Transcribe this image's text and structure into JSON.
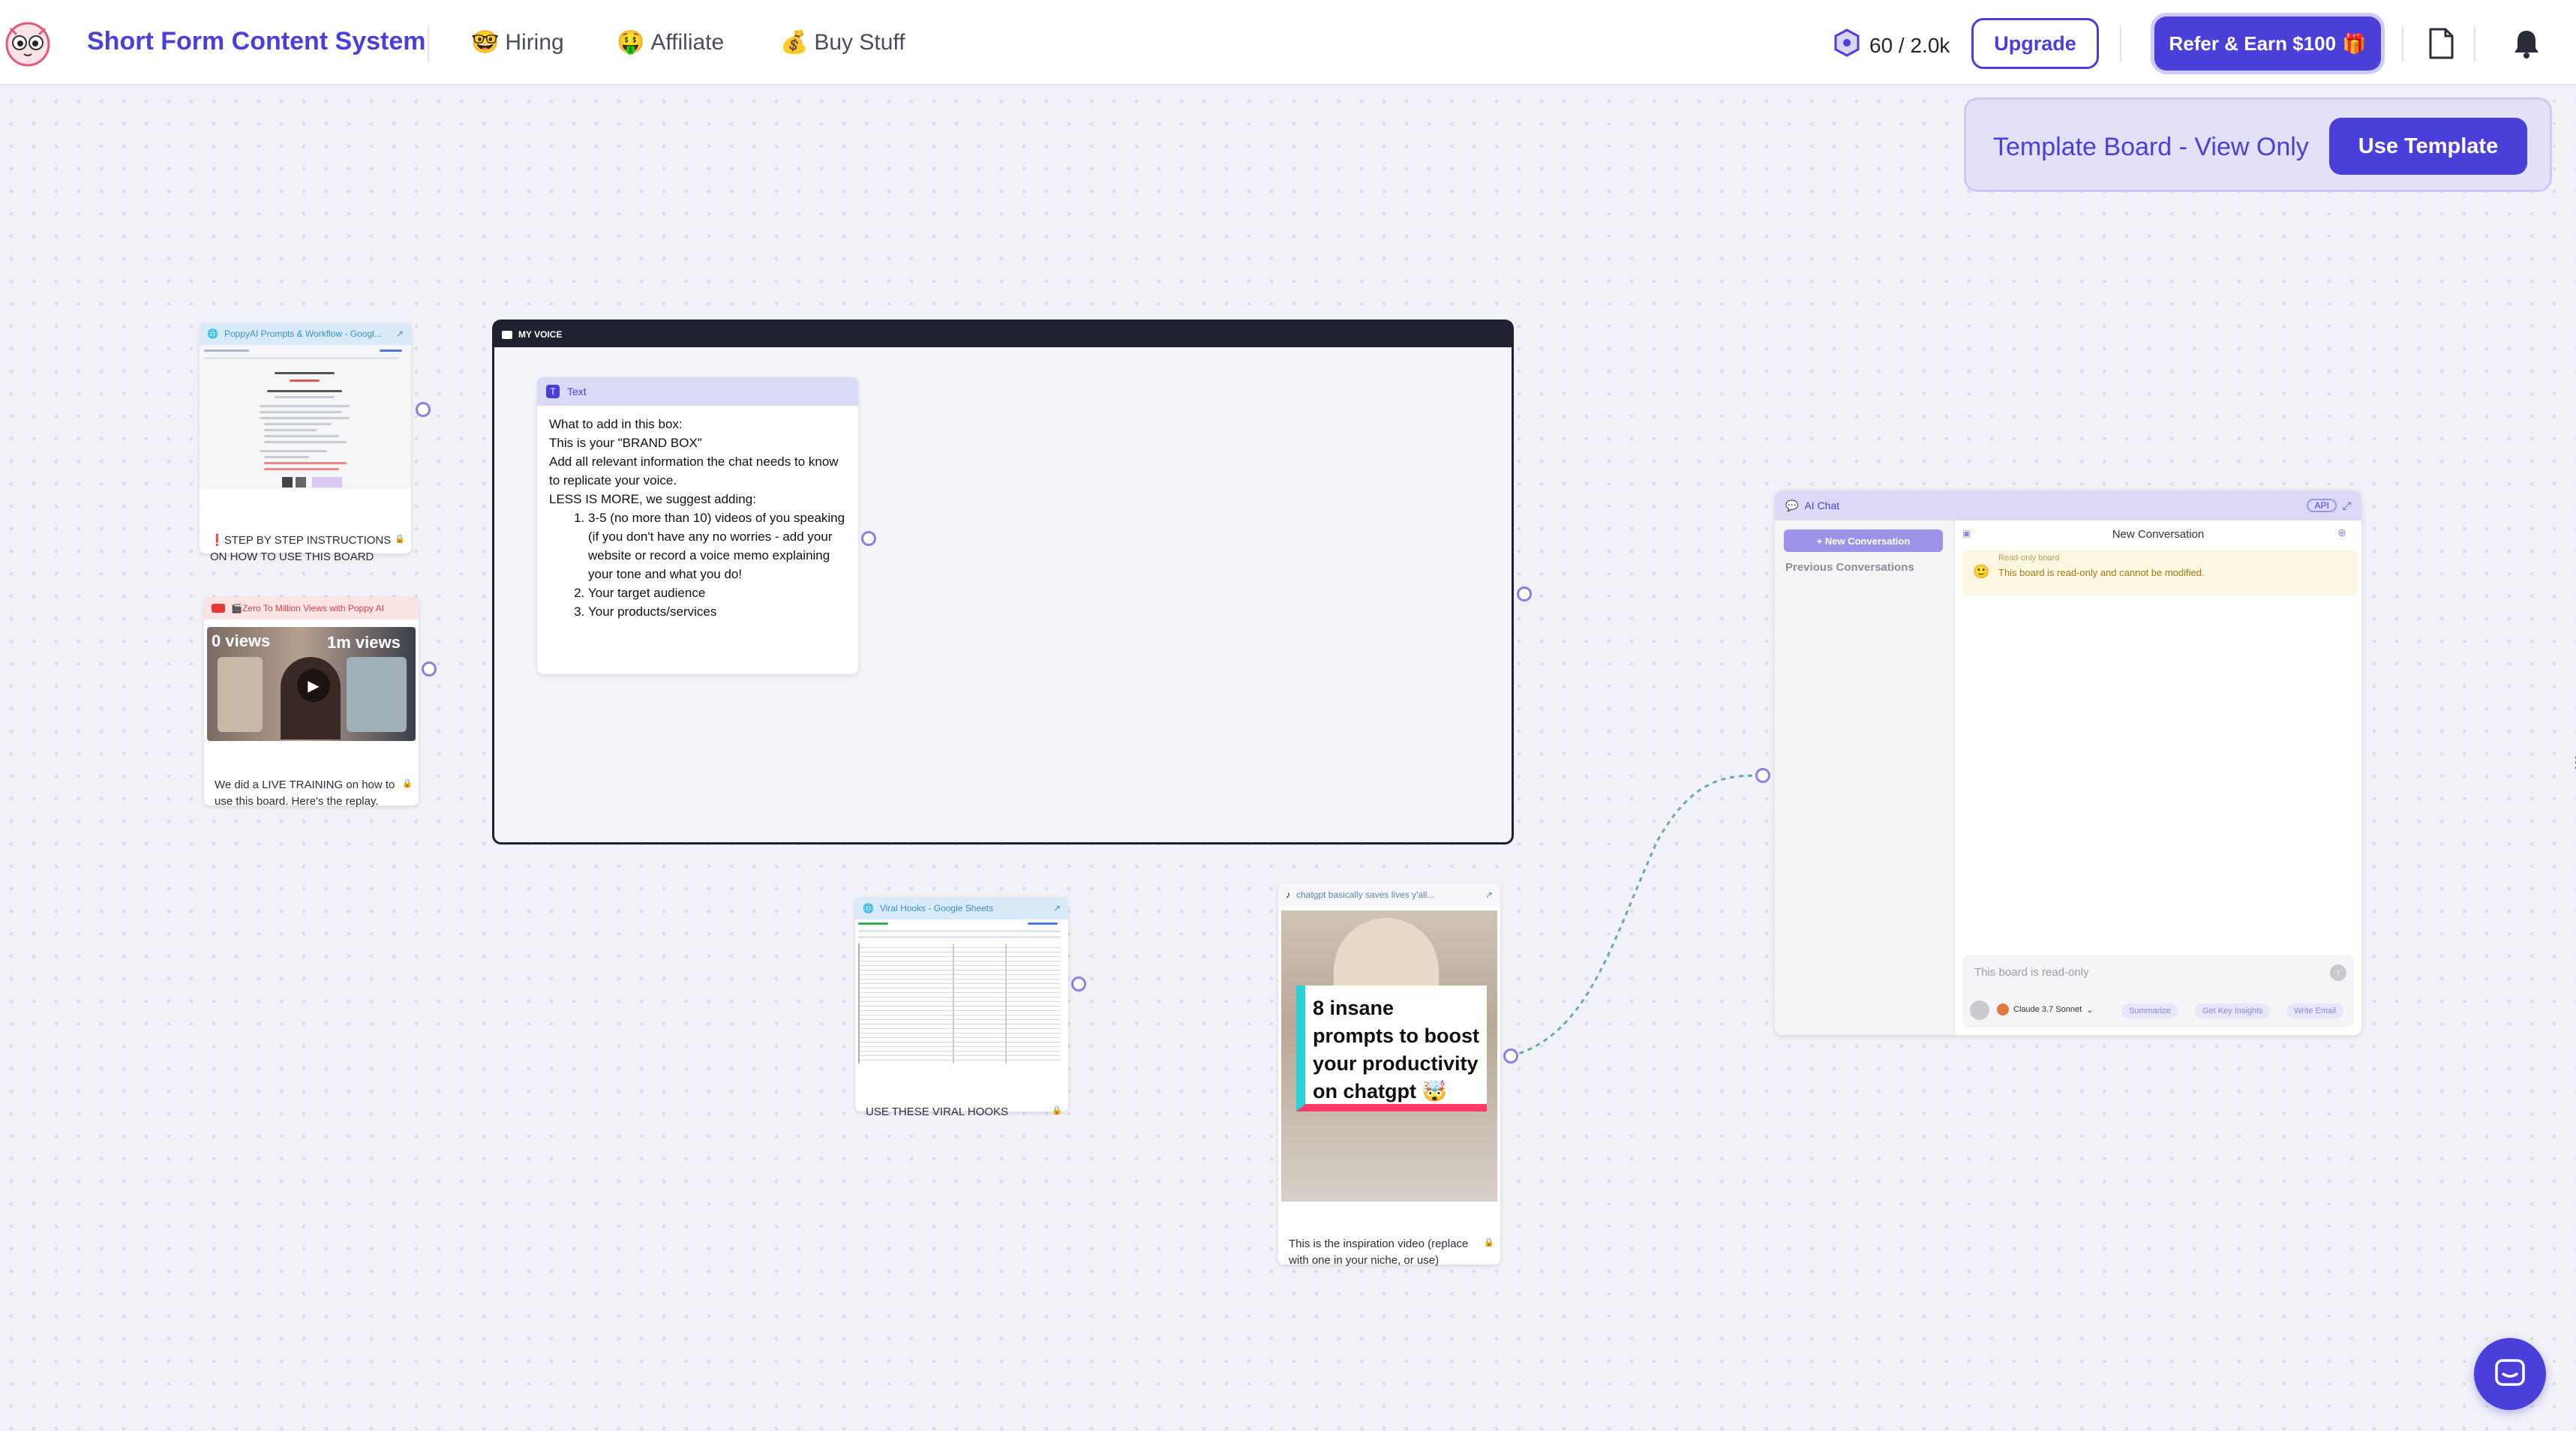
{
  "header": {
    "brand": "Short Form Content System",
    "nav": [
      {
        "icon": "🤓",
        "label": "Hiring"
      },
      {
        "icon": "🤑",
        "label": "Affiliate"
      },
      {
        "icon": "💰",
        "label": "Buy Stuff"
      }
    ],
    "credits": "60 / 2.0k",
    "upgrade_label": "Upgrade",
    "refer_label": "Refer & Earn $100",
    "refer_icon": "🎁"
  },
  "banner": {
    "text": "Template Board - View Only",
    "button_label": "Use Template"
  },
  "cards": {
    "prompts_doc": {
      "title": "PoppyAI Prompts & Workflow - Googl...",
      "caption_icon": "❗",
      "caption": "STEP BY STEP INSTRUCTIONS ON HOW TO USE THIS BOARD"
    },
    "youtube": {
      "title": "🎬Zero To Million Views with Poppy AI",
      "thumb_left": "0 views",
      "thumb_right": "1m views",
      "caption": "We did a LIVE TRAINING on how to use this board. Here's the replay."
    },
    "viral_hooks": {
      "title": "Viral Hooks - Google Sheets",
      "caption": "USE THESE VIRAL HOOKS"
    },
    "tiktok": {
      "title": "chatgpt basically saves lives y'all...",
      "overlay": "8 insane prompts to boost your productivity on chatgpt 🤯",
      "caption": "This is the inspiration video (replace with one in your niche, or use)"
    }
  },
  "group": {
    "title": "MY VOICE",
    "text_card": {
      "header": "Text",
      "lines": [
        "What to add in this box:",
        "This is your \"BRAND BOX\"",
        "Add all relevant information the chat needs to know to replicate your voice.",
        "LESS IS MORE, we suggest adding:"
      ],
      "list": [
        "3-5 (no more than 10) videos of you speaking (if you don't have any no worries - add your website or record a voice memo explaining your tone and what you do!",
        "Your target audience",
        "Your products/services"
      ]
    }
  },
  "chat": {
    "title": "AI Chat",
    "api_label": "API",
    "new_conversation": "+ New Conversation",
    "previous": "Previous Conversations",
    "conversation_title": "New Conversation",
    "readonly_notice": "This board is read-only and cannot be modified.",
    "readonly_hidden": "Read-only board",
    "input_placeholder": "This board is read-only",
    "model": "Claude 3.7 Sonnet",
    "actions": [
      "Summarize",
      "Get Key Insights",
      "Write Email"
    ]
  },
  "colors": {
    "accent": "#4b3fd9",
    "background": "#f1f2f7"
  }
}
